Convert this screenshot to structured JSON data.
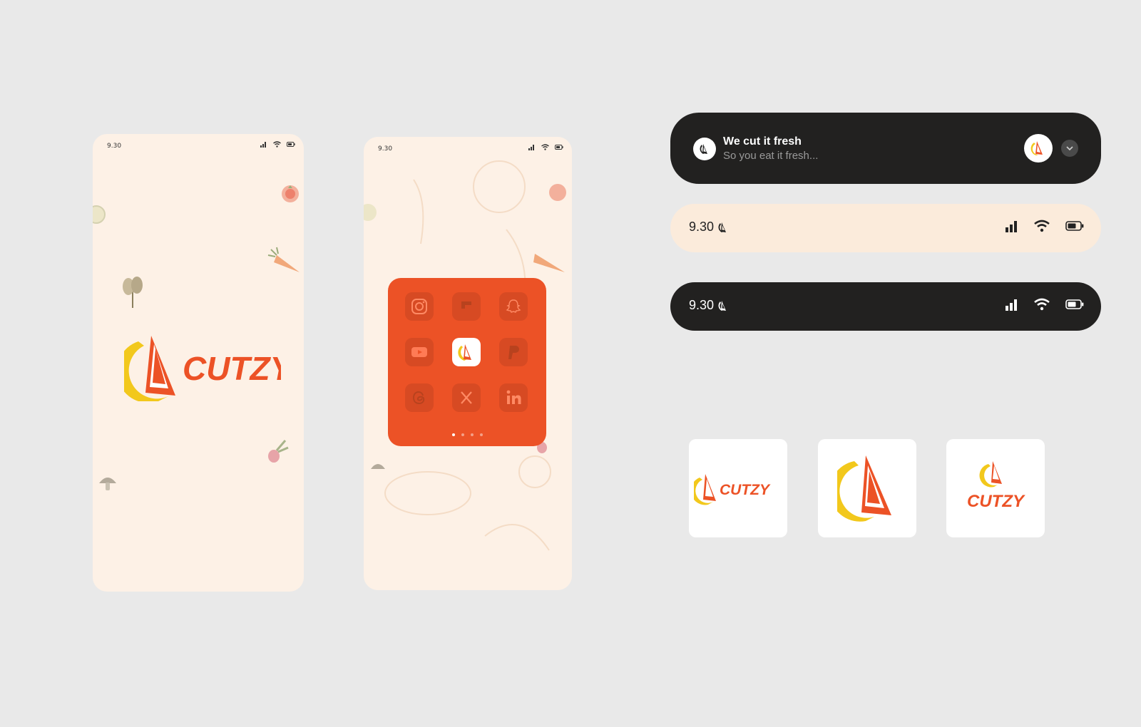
{
  "phones": [
    {
      "status_time": "9.30",
      "logo_text": "CUTZY"
    },
    {
      "status_time": "9.30",
      "folder_page_count": 4,
      "folder_active_page": 1
    }
  ],
  "folder": {
    "apps": [
      "instagram-icon",
      "flipboard-icon",
      "snapchat-icon",
      "youtube-icon",
      "cutzy-app-icon",
      "paypal-icon",
      "threads-icon",
      "x-icon",
      "linkedin-icon"
    ]
  },
  "notification": {
    "title": "We cut it fresh",
    "subtitle": "So you eat it fresh..."
  },
  "status_bar_light": {
    "time": "9.30"
  },
  "status_bar_dark": {
    "time": "9.30"
  },
  "logo_tiles": [
    {
      "variant": "horizontal",
      "text": "CUTZY"
    },
    {
      "variant": "symbol",
      "text": ""
    },
    {
      "variant": "stacked",
      "text": "CUTZY"
    }
  ],
  "colors": {
    "brand_orange": "#ec5226",
    "brand_yellow": "#f2c81c",
    "cream": "#fdf1e6",
    "dark": "#222120",
    "page_bg": "#e9e9e9"
  }
}
